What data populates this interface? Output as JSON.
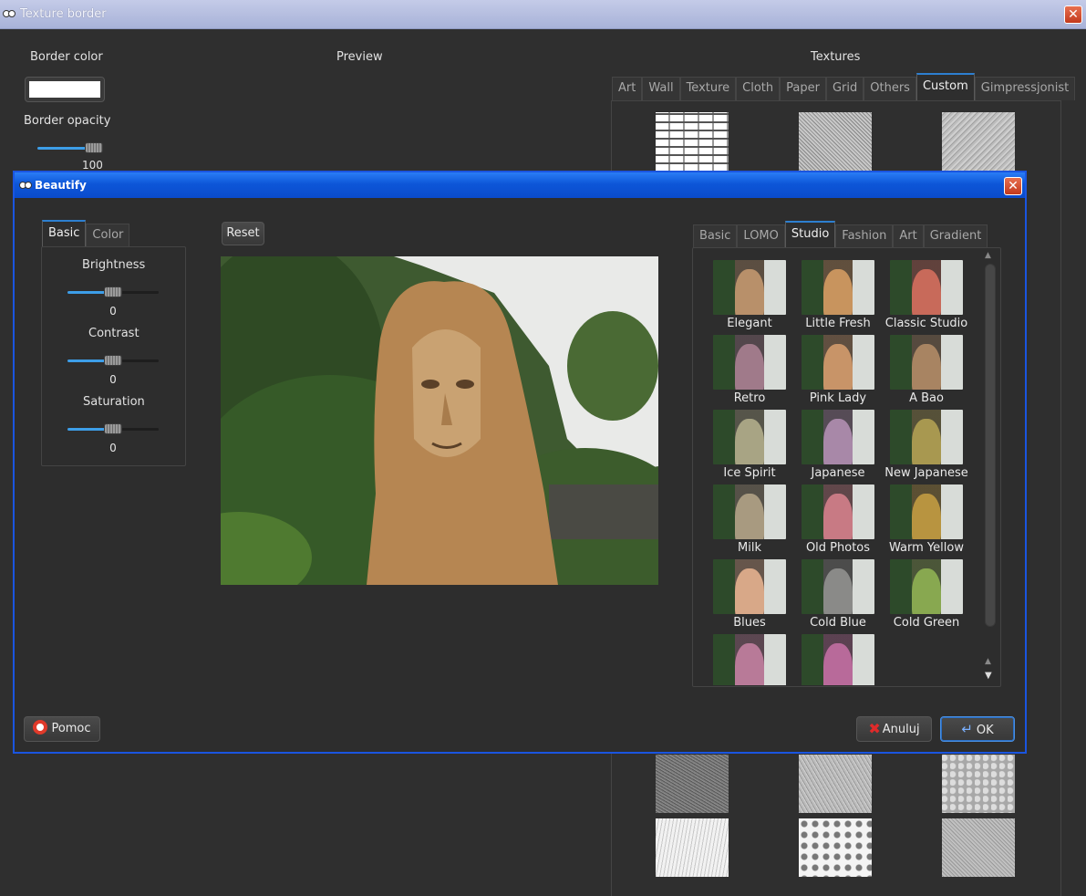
{
  "back_window": {
    "title": "Texture border",
    "border_color_label": "Border color",
    "border_color": "#ffffff",
    "border_opacity_label": "Border opacity",
    "border_opacity_value": "100",
    "preview_label": "Preview",
    "textures_label": "Textures",
    "texture_tabs": [
      "Art",
      "Wall",
      "Texture",
      "Cloth",
      "Paper",
      "Grid",
      "Others",
      "Custom",
      "Gimpressjonist"
    ],
    "active_texture_tab": "Custom"
  },
  "dialog": {
    "title": "Beautify",
    "left_tabs": [
      "Basic",
      "Color"
    ],
    "active_left_tab": "Basic",
    "brightness_label": "Brightness",
    "brightness_value": "0",
    "contrast_label": "Contrast",
    "contrast_value": "0",
    "saturation_label": "Saturation",
    "saturation_value": "0",
    "reset_label": "Reset",
    "right_tabs": [
      "Basic",
      "LOMO",
      "Studio",
      "Fashion",
      "Art",
      "Gradient"
    ],
    "active_right_tab": "Studio",
    "filters": [
      {
        "name": "Elegant",
        "tint": "#b8906a"
      },
      {
        "name": "Little Fresh",
        "tint": "#c8945e"
      },
      {
        "name": "Classic Studio",
        "tint": "#c86a5a"
      },
      {
        "name": "Retro",
        "tint": "#a07a8a"
      },
      {
        "name": "Pink Lady",
        "tint": "#c89468"
      },
      {
        "name": "A Bao",
        "tint": "#a88462"
      },
      {
        "name": "Ice Spirit",
        "tint": "#a8a484"
      },
      {
        "name": "Japanese",
        "tint": "#a888a8"
      },
      {
        "name": "New Japanese",
        "tint": "#a89850"
      },
      {
        "name": "Milk",
        "tint": "#a89a80"
      },
      {
        "name": "Old Photos",
        "tint": "#c87a84"
      },
      {
        "name": "Warm Yellow",
        "tint": "#b89440"
      },
      {
        "name": "Blues",
        "tint": "#d8a888"
      },
      {
        "name": "Cold Blue",
        "tint": "#8a8a88"
      },
      {
        "name": "Cold Green",
        "tint": "#88a850"
      },
      {
        "name": "",
        "tint": "#b87a98"
      },
      {
        "name": "",
        "tint": "#b86a9a"
      }
    ],
    "help_label": "Pomoc",
    "cancel_label": "Anuluj",
    "ok_label": "OK"
  }
}
